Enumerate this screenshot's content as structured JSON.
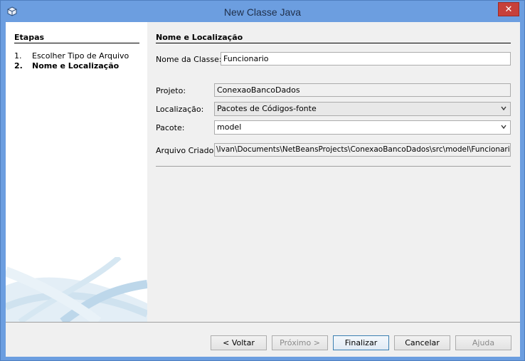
{
  "window": {
    "title": "New Classe Java",
    "close_glyph": "✕",
    "icon": "cube-icon"
  },
  "steps": {
    "title": "Etapas",
    "items": [
      {
        "num": "1.",
        "label": "Escolher Tipo de Arquivo"
      },
      {
        "num": "2.",
        "label": "Nome e Localização"
      }
    ]
  },
  "section": {
    "title": "Nome e Localização"
  },
  "form": {
    "class_name": {
      "label": "Nome da Classe:",
      "value": "Funcionario"
    },
    "project": {
      "label": "Projeto:",
      "value": "ConexaoBancoDados"
    },
    "location": {
      "label": "Localização:",
      "value": "Pacotes de Códigos-fonte"
    },
    "package": {
      "label": "Pacote:",
      "value": "model"
    },
    "created_file": {
      "label": "Arquivo Criado:",
      "value": "\\Ivan\\Documents\\NetBeansProjects\\ConexaoBancoDados\\src\\model\\Funcionario.java"
    }
  },
  "buttons": {
    "back": "< Voltar",
    "next": "Próximo >",
    "finish": "Finalizar",
    "cancel": "Cancelar",
    "help": "Ajuda"
  },
  "colors": {
    "titlebar": "#6c9ee0",
    "close": "#c7403a",
    "panel": "#f0f0f0",
    "steps_bg": "#ffffff"
  }
}
